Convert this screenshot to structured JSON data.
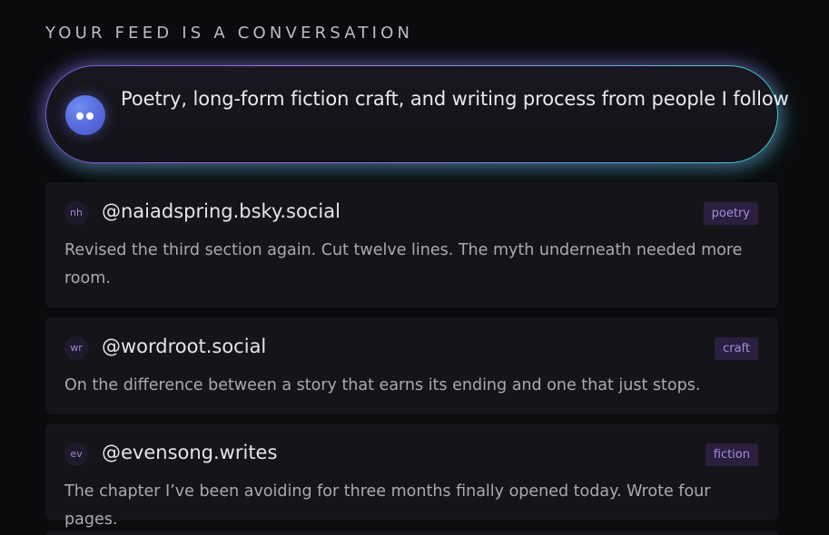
{
  "section": {
    "title": "YOUR FEED IS A CONVERSATION"
  },
  "prompt": {
    "text": "Poetry, long-form fiction craft, and writing process from people I follow",
    "icon": "bot-face-icon"
  },
  "posts": [
    {
      "avatar_initials": "nh",
      "handle": "@naiadspring.bsky.social",
      "tag": "poetry",
      "body": "Revised the third section again. Cut twelve lines. The myth underneath needed more room."
    },
    {
      "avatar_initials": "wr",
      "handle": "@wordroot.social",
      "tag": "craft",
      "body": "On the difference between a story that earns its ending and one that just stops."
    },
    {
      "avatar_initials": "ev",
      "handle": "@evensong.writes",
      "tag": "fiction",
      "body": "The chapter I’ve been avoiding for three months finally opened today. Wrote four pages."
    }
  ],
  "colors": {
    "background": "#0b0b0d",
    "card": "#151519",
    "tag_bg": "#2a1f3e",
    "tag_text": "#a88ae0",
    "glow_start": "#7a5cd6",
    "glow_end": "#3cd0c6"
  }
}
